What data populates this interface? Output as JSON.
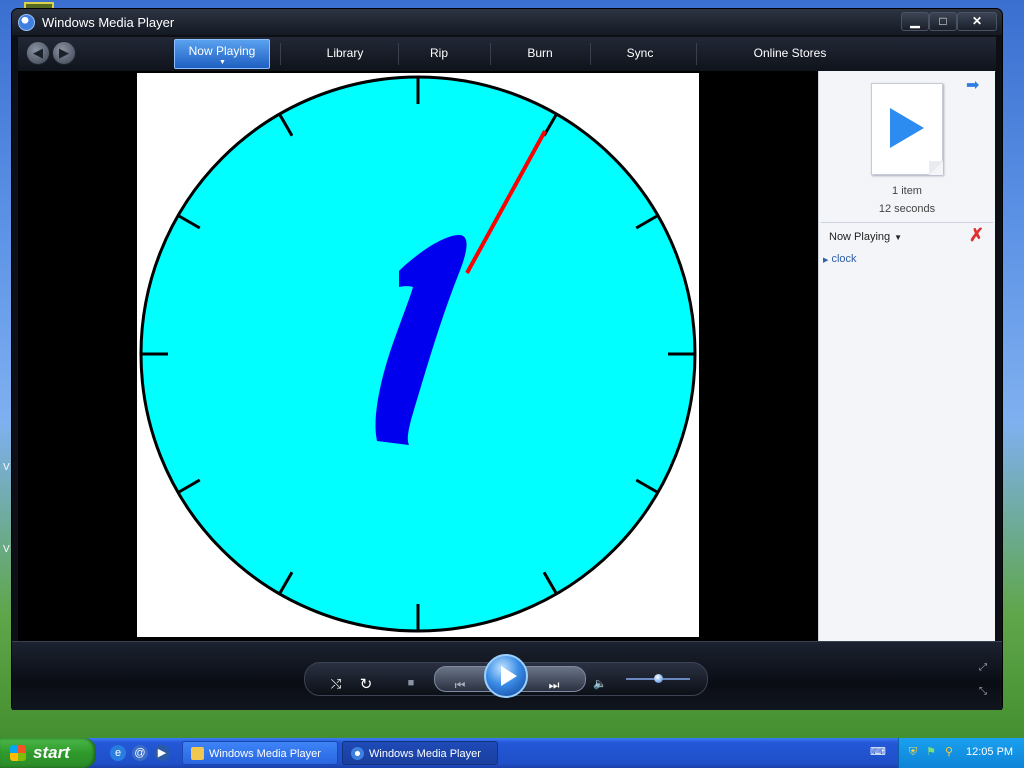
{
  "window": {
    "title": "Windows Media Player",
    "minimize": "▁",
    "maximize": "□",
    "close": "✕"
  },
  "nav": {
    "back_icon": "back-arrow-icon",
    "forward_icon": "forward-arrow-icon",
    "tabs": [
      {
        "label": "Now Playing",
        "active": true
      },
      {
        "label": "Library"
      },
      {
        "label": "Rip"
      },
      {
        "label": "Burn"
      },
      {
        "label": "Sync"
      },
      {
        "label": "Online Stores"
      }
    ]
  },
  "video": {
    "clock": {
      "face_color": "#00ffff",
      "digit": "1",
      "digit_color": "#0000ee",
      "second_hand_color": "#ff0000"
    }
  },
  "panel": {
    "item_count": "1 item",
    "duration": "12 seconds",
    "now_playing_label": "Now Playing",
    "dropdown_glyph": "▼",
    "items": [
      {
        "label": "clock"
      }
    ]
  },
  "controls": {
    "shuffle": "⤭",
    "repeat": "↻",
    "stop": "■",
    "prev": "⏮",
    "next": "⏭",
    "mute": "🔈",
    "volume": 0.5
  },
  "taskbar": {
    "start_label": "start",
    "tasks": [
      {
        "label": "Windows Media Player",
        "active": false
      },
      {
        "label": "Windows Media Player",
        "active": true
      }
    ],
    "clock": "12:05 PM"
  },
  "colors": {
    "accent": "#2d8cf0",
    "taskbar_blue": "#2458d8"
  }
}
